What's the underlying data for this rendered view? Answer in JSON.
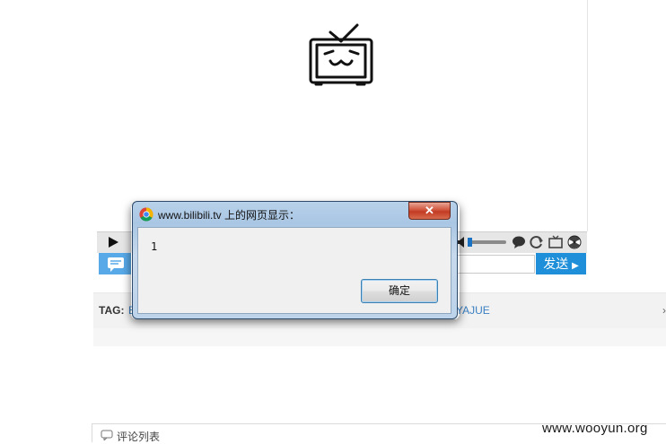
{
  "dialog": {
    "title": "www.bilibili.tv 上的网页显示：",
    "message": "1",
    "ok_label": "确定",
    "close_symbol": "✕"
  },
  "player": {
    "send_label": "发送",
    "icons": [
      "play-icon",
      "volume-icon",
      "comment-bubble-icon",
      "loop-icon",
      "tv-icon",
      "radiation-icon"
    ]
  },
  "tags": {
    "label": "TAG:",
    "first_fragment": "B",
    "last_fragment": "YAJUE",
    "more": "›"
  },
  "comments": {
    "title": "评论列表"
  },
  "watermark": "www.wooyun.org",
  "colors": {
    "accent": "#1e8fd8",
    "link": "#3a7fc1",
    "danmaku": "#58a9e8"
  }
}
